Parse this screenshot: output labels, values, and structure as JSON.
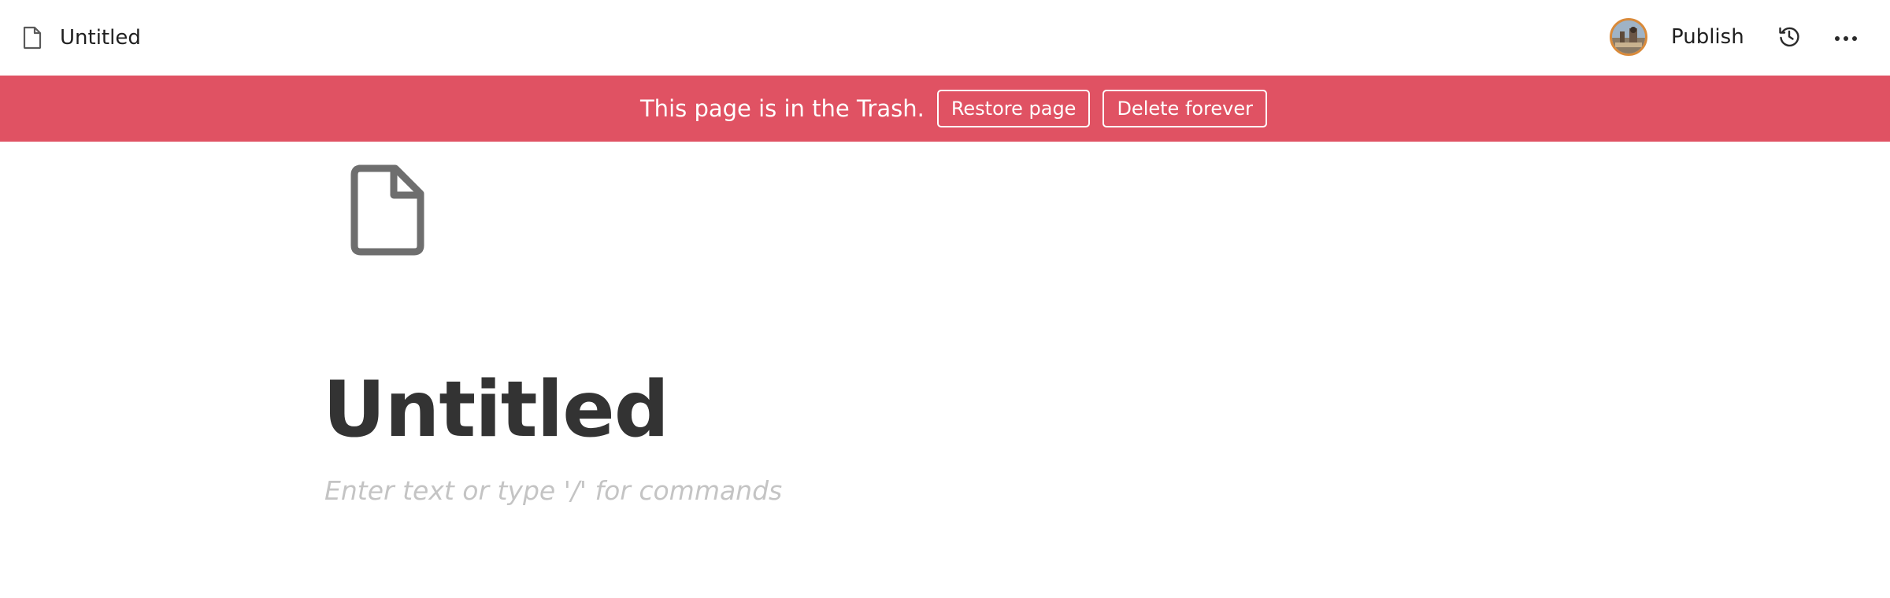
{
  "topbar": {
    "breadcrumb_title": "Untitled",
    "breadcrumb_icon": "document-icon",
    "avatar_icon": "user-avatar",
    "publish_label": "Publish",
    "history_icon": "history-icon",
    "more_icon": "more-horizontal-icon"
  },
  "banner": {
    "message": "This page is in the Trash.",
    "restore_label": "Restore page",
    "delete_label": "Delete forever",
    "color": "#e05263"
  },
  "page": {
    "icon": "document-icon",
    "title": "Untitled",
    "placeholder": "Enter text or type '/' for commands"
  }
}
